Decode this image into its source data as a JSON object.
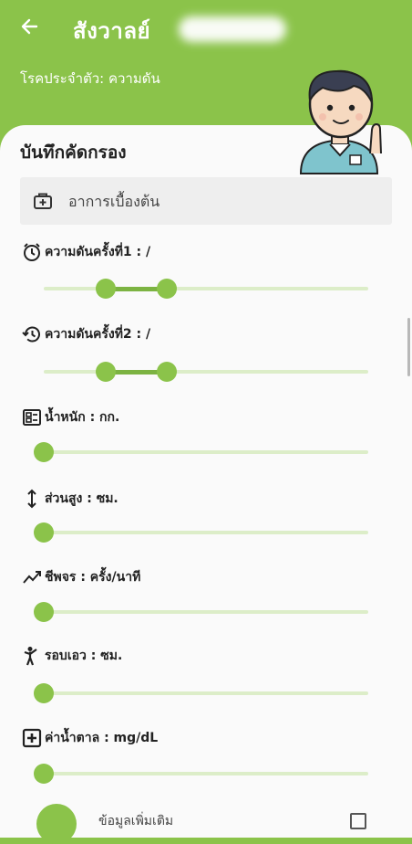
{
  "header": {
    "title": "สังวาลย์",
    "subtitle": "โรคประจำตัว: ความดัน"
  },
  "card": {
    "title": "บันทึกคัดกรอง",
    "section_label": "อาการเบื้องต้น"
  },
  "measurements": [
    {
      "label": "ความดันครั้งที่1 : /",
      "icon": "alarm-icon",
      "low": 0.19,
      "high": 0.38
    },
    {
      "label": "ความดันครั้งที่2 : /",
      "icon": "history-icon",
      "low": 0.19,
      "high": 0.38
    },
    {
      "label": "น้ำหนัก :  กก.",
      "icon": "scale-icon",
      "value": 0
    },
    {
      "label": "ส่วนสูง :  ซม.",
      "icon": "height-icon",
      "value": 0
    },
    {
      "label": "ชีพจร :  ครั้ง/นาที",
      "icon": "pulse-icon",
      "value": 0
    },
    {
      "label": "รอบเอว :  ซม.",
      "icon": "waist-icon",
      "value": 0
    },
    {
      "label": "ค่าน้ำตาล :  mg/dL",
      "icon": "sugar-icon",
      "value": 0
    }
  ],
  "bottom": {
    "label": "ข้อมูลเพิ่มเติม"
  },
  "colors": {
    "accent": "#8bc34a",
    "range": "#7cb342",
    "track": "#dcedc8"
  }
}
